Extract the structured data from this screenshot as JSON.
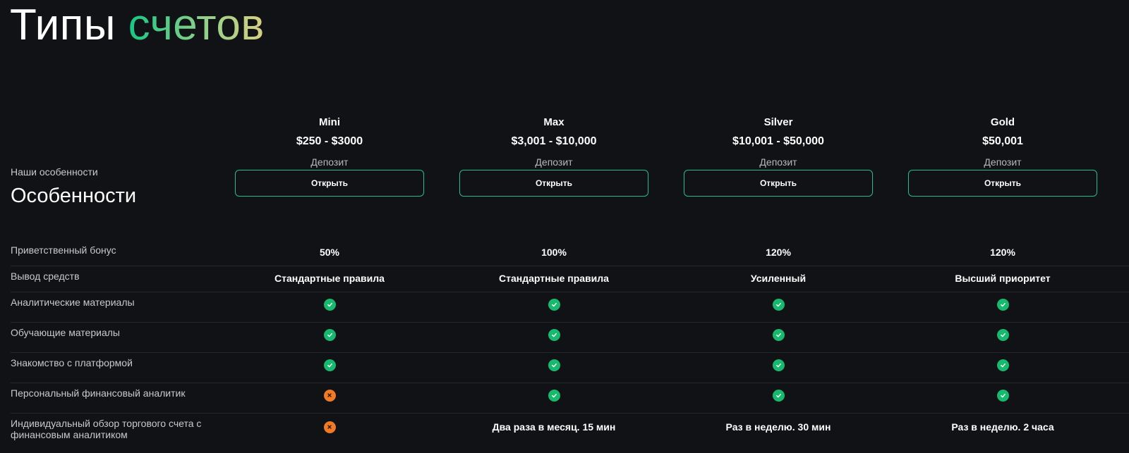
{
  "header": {
    "title_main": "Типы",
    "title_accent": "счетов"
  },
  "features": {
    "subtitle": "Наши особенности",
    "title": "Особенности"
  },
  "plans": [
    {
      "name": "Mini",
      "range": "$250 - $3000",
      "deposit_label": "Депозит",
      "button": "Открыть"
    },
    {
      "name": "Max",
      "range": "$3,001 - $10,000",
      "deposit_label": "Депозит",
      "button": "Открыть"
    },
    {
      "name": "Silver",
      "range": "$10,001 - $50,000",
      "deposit_label": "Депозит",
      "button": "Открыть"
    },
    {
      "name": "Gold",
      "range": "$50,001",
      "deposit_label": "Депозит",
      "button": "Открыть"
    }
  ],
  "rows": [
    {
      "label": "Приветственный бонус",
      "values": [
        {
          "type": "text",
          "text": "50%"
        },
        {
          "type": "text",
          "text": "100%"
        },
        {
          "type": "text",
          "text": "120%"
        },
        {
          "type": "text",
          "text": "120%"
        }
      ]
    },
    {
      "label": "Вывод средств",
      "values": [
        {
          "type": "text",
          "text": "Стандартные правила"
        },
        {
          "type": "text",
          "text": "Стандартные правила"
        },
        {
          "type": "text",
          "text": "Усиленный"
        },
        {
          "type": "text",
          "text": "Высший приоритет"
        }
      ]
    },
    {
      "label": "Аналитические материалы",
      "values": [
        {
          "type": "check"
        },
        {
          "type": "check"
        },
        {
          "type": "check"
        },
        {
          "type": "check"
        }
      ]
    },
    {
      "label": "Обучающие материалы",
      "values": [
        {
          "type": "check"
        },
        {
          "type": "check"
        },
        {
          "type": "check"
        },
        {
          "type": "check"
        }
      ]
    },
    {
      "label": "Знакомство с платформой",
      "values": [
        {
          "type": "check"
        },
        {
          "type": "check"
        },
        {
          "type": "check"
        },
        {
          "type": "check"
        }
      ]
    },
    {
      "label": "Персональный финансовый аналитик",
      "values": [
        {
          "type": "cross"
        },
        {
          "type": "check"
        },
        {
          "type": "check"
        },
        {
          "type": "check"
        }
      ]
    },
    {
      "label": "Индивидуальный обзор торгового счета с финансовым аналитиком",
      "values": [
        {
          "type": "cross"
        },
        {
          "type": "text",
          "text": "Два раза в месяц. 15 мин"
        },
        {
          "type": "text",
          "text": "Раз в неделю. 30 мин"
        },
        {
          "type": "text",
          "text": "Раз в неделю. 2 часа"
        }
      ]
    }
  ],
  "icons": {
    "check": "check-icon",
    "cross": "cross-icon"
  },
  "colors": {
    "accent": "#16c784",
    "check": "#16b96d",
    "cross": "#f07a25",
    "button_border": "#1fbf85",
    "background": "#111215"
  }
}
